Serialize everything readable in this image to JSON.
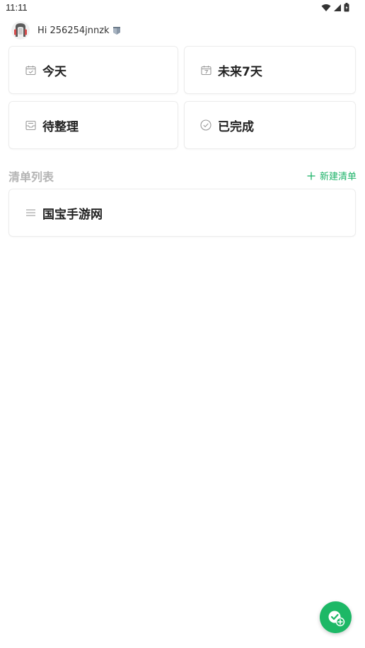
{
  "status_bar": {
    "time": "11:11",
    "icons": [
      "wifi-icon",
      "signal-icon",
      "battery-icon"
    ]
  },
  "header": {
    "greeting": "Hi 256254jnnzk",
    "avatar_icon": "avatar",
    "badge_icon": "badge-icon"
  },
  "smart_lists": [
    {
      "label": "今天",
      "icon": "calendar-check-icon"
    },
    {
      "label": "未来7天",
      "icon": "calendar-7-icon"
    },
    {
      "label": "待整理",
      "icon": "inbox-icon"
    },
    {
      "label": "已完成",
      "icon": "check-circle-icon"
    }
  ],
  "lists_section": {
    "title": "清单列表",
    "new_list_label": "新建清单",
    "items": [
      {
        "label": "国宝手游网",
        "icon": "menu-lines-icon"
      }
    ]
  },
  "fab": {
    "icon": "add-task-icon"
  },
  "colors": {
    "accent": "#1db866",
    "section_title": "#b5b5b5",
    "icon_gray": "#9a9a9a"
  }
}
